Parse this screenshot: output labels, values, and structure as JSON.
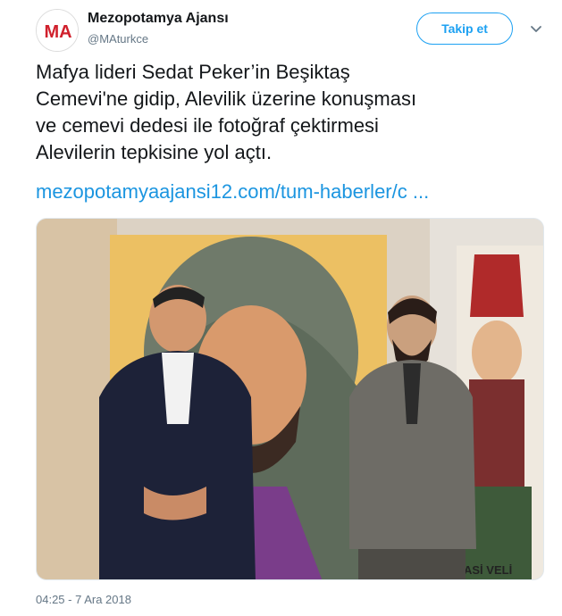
{
  "account": {
    "name": "Mezopotamya Ajansı",
    "handle": "@MAturkce",
    "avatar_initials": "MA"
  },
  "follow_label": "Takip et",
  "tweet": {
    "text": "Mafya lideri Sedat Peker’in Beşiktaş\nCemevi'ne gidip, Alevilik üzerine konuşması\nve cemevi dedesi ile fotoğraf çektirmesi\nAlevilerin tepkisine yol açtı.",
    "link": "mezopotamyaajansi12.com/tum-haberler/c ...",
    "timestamp": "04:25 - 7 Ara 2018"
  },
  "photo": {
    "banner_text": "ASİ VELİ"
  },
  "colors": {
    "accent": "#1da1f2",
    "link": "#1b95e0",
    "secondary_text": "#657786",
    "brand_red": "#d0202c"
  },
  "icons": {
    "menu": "chevron-down-icon"
  }
}
